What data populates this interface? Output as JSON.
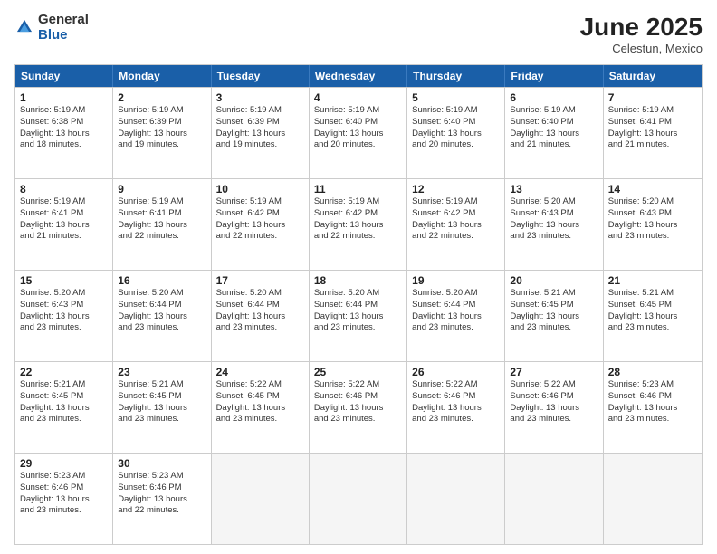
{
  "header": {
    "logo_general": "General",
    "logo_blue": "Blue",
    "month_title": "June 2025",
    "location": "Celestun, Mexico"
  },
  "weekdays": [
    "Sunday",
    "Monday",
    "Tuesday",
    "Wednesday",
    "Thursday",
    "Friday",
    "Saturday"
  ],
  "rows": [
    [
      {
        "day": "1",
        "info": "Sunrise: 5:19 AM\nSunset: 6:38 PM\nDaylight: 13 hours\nand 18 minutes."
      },
      {
        "day": "2",
        "info": "Sunrise: 5:19 AM\nSunset: 6:39 PM\nDaylight: 13 hours\nand 19 minutes."
      },
      {
        "day": "3",
        "info": "Sunrise: 5:19 AM\nSunset: 6:39 PM\nDaylight: 13 hours\nand 19 minutes."
      },
      {
        "day": "4",
        "info": "Sunrise: 5:19 AM\nSunset: 6:40 PM\nDaylight: 13 hours\nand 20 minutes."
      },
      {
        "day": "5",
        "info": "Sunrise: 5:19 AM\nSunset: 6:40 PM\nDaylight: 13 hours\nand 20 minutes."
      },
      {
        "day": "6",
        "info": "Sunrise: 5:19 AM\nSunset: 6:40 PM\nDaylight: 13 hours\nand 21 minutes."
      },
      {
        "day": "7",
        "info": "Sunrise: 5:19 AM\nSunset: 6:41 PM\nDaylight: 13 hours\nand 21 minutes."
      }
    ],
    [
      {
        "day": "8",
        "info": "Sunrise: 5:19 AM\nSunset: 6:41 PM\nDaylight: 13 hours\nand 21 minutes."
      },
      {
        "day": "9",
        "info": "Sunrise: 5:19 AM\nSunset: 6:41 PM\nDaylight: 13 hours\nand 22 minutes."
      },
      {
        "day": "10",
        "info": "Sunrise: 5:19 AM\nSunset: 6:42 PM\nDaylight: 13 hours\nand 22 minutes."
      },
      {
        "day": "11",
        "info": "Sunrise: 5:19 AM\nSunset: 6:42 PM\nDaylight: 13 hours\nand 22 minutes."
      },
      {
        "day": "12",
        "info": "Sunrise: 5:19 AM\nSunset: 6:42 PM\nDaylight: 13 hours\nand 22 minutes."
      },
      {
        "day": "13",
        "info": "Sunrise: 5:20 AM\nSunset: 6:43 PM\nDaylight: 13 hours\nand 23 minutes."
      },
      {
        "day": "14",
        "info": "Sunrise: 5:20 AM\nSunset: 6:43 PM\nDaylight: 13 hours\nand 23 minutes."
      }
    ],
    [
      {
        "day": "15",
        "info": "Sunrise: 5:20 AM\nSunset: 6:43 PM\nDaylight: 13 hours\nand 23 minutes."
      },
      {
        "day": "16",
        "info": "Sunrise: 5:20 AM\nSunset: 6:44 PM\nDaylight: 13 hours\nand 23 minutes."
      },
      {
        "day": "17",
        "info": "Sunrise: 5:20 AM\nSunset: 6:44 PM\nDaylight: 13 hours\nand 23 minutes."
      },
      {
        "day": "18",
        "info": "Sunrise: 5:20 AM\nSunset: 6:44 PM\nDaylight: 13 hours\nand 23 minutes."
      },
      {
        "day": "19",
        "info": "Sunrise: 5:20 AM\nSunset: 6:44 PM\nDaylight: 13 hours\nand 23 minutes."
      },
      {
        "day": "20",
        "info": "Sunrise: 5:21 AM\nSunset: 6:45 PM\nDaylight: 13 hours\nand 23 minutes."
      },
      {
        "day": "21",
        "info": "Sunrise: 5:21 AM\nSunset: 6:45 PM\nDaylight: 13 hours\nand 23 minutes."
      }
    ],
    [
      {
        "day": "22",
        "info": "Sunrise: 5:21 AM\nSunset: 6:45 PM\nDaylight: 13 hours\nand 23 minutes."
      },
      {
        "day": "23",
        "info": "Sunrise: 5:21 AM\nSunset: 6:45 PM\nDaylight: 13 hours\nand 23 minutes."
      },
      {
        "day": "24",
        "info": "Sunrise: 5:22 AM\nSunset: 6:45 PM\nDaylight: 13 hours\nand 23 minutes."
      },
      {
        "day": "25",
        "info": "Sunrise: 5:22 AM\nSunset: 6:46 PM\nDaylight: 13 hours\nand 23 minutes."
      },
      {
        "day": "26",
        "info": "Sunrise: 5:22 AM\nSunset: 6:46 PM\nDaylight: 13 hours\nand 23 minutes."
      },
      {
        "day": "27",
        "info": "Sunrise: 5:22 AM\nSunset: 6:46 PM\nDaylight: 13 hours\nand 23 minutes."
      },
      {
        "day": "28",
        "info": "Sunrise: 5:23 AM\nSunset: 6:46 PM\nDaylight: 13 hours\nand 23 minutes."
      }
    ],
    [
      {
        "day": "29",
        "info": "Sunrise: 5:23 AM\nSunset: 6:46 PM\nDaylight: 13 hours\nand 23 minutes."
      },
      {
        "day": "30",
        "info": "Sunrise: 5:23 AM\nSunset: 6:46 PM\nDaylight: 13 hours\nand 22 minutes."
      },
      {
        "day": "",
        "info": ""
      },
      {
        "day": "",
        "info": ""
      },
      {
        "day": "",
        "info": ""
      },
      {
        "day": "",
        "info": ""
      },
      {
        "day": "",
        "info": ""
      }
    ]
  ]
}
